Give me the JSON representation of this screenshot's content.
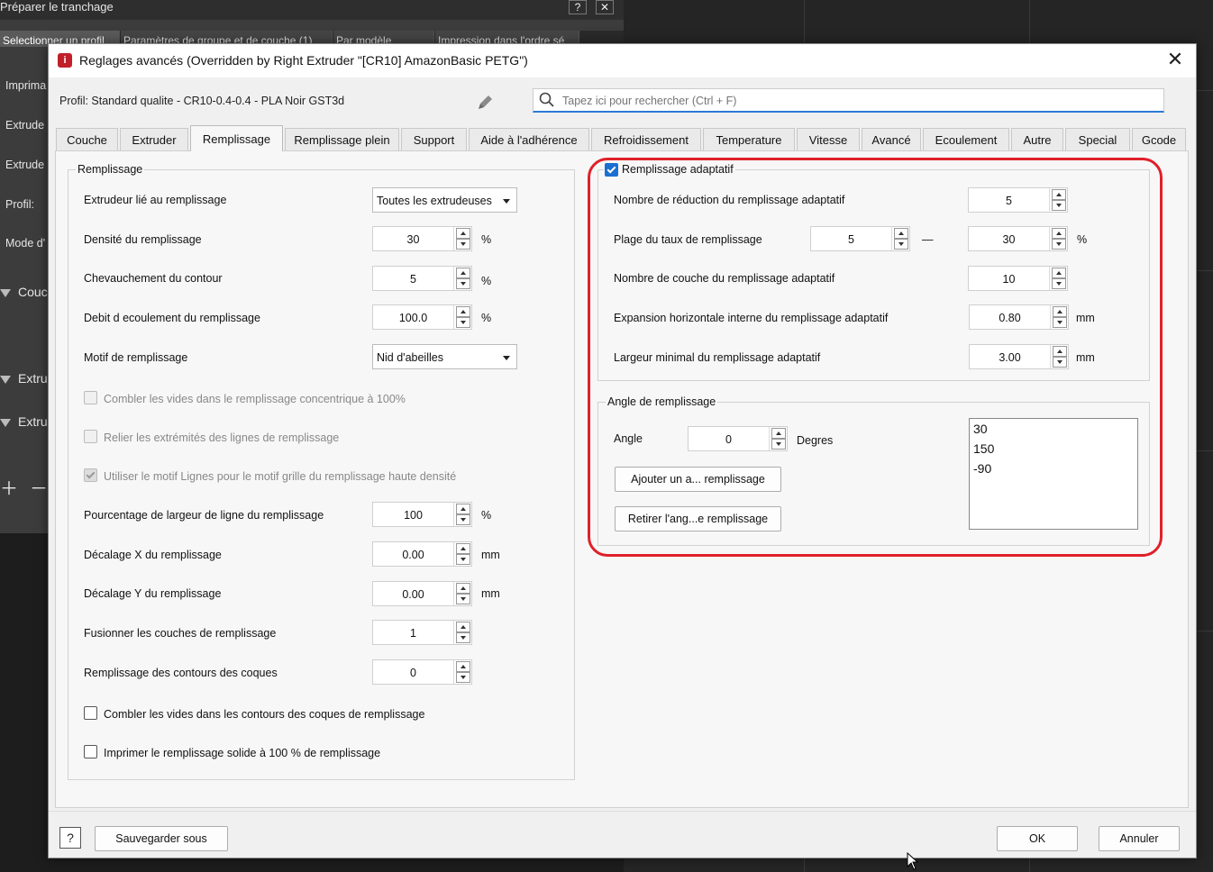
{
  "background_app": {
    "title": "Préparer le tranchage",
    "help_label": "?",
    "close_label": "✕",
    "tabs": [
      "Selectionner un profil",
      "Paramètres de groupe et de couche (1)",
      "Par modèle",
      "Impression dans l'ordre sé"
    ],
    "side_labels": [
      "Imprima",
      "Extrude",
      "Extrude",
      "Profil:",
      "Mode d'"
    ],
    "tree_items": [
      "Couc",
      "Extru",
      "Extru"
    ]
  },
  "dialog": {
    "title": "Reglages avancés (Overridden by Right Extruder \"[CR10] AmazonBasic PETG\")",
    "icon_label": "i",
    "close_label": "✕",
    "profile_label": "Profil: Standard qualite - CR10-0.4-0.4 - PLA Noir GST3d",
    "search_placeholder": "Tapez ici pour rechercher (Ctrl + F)",
    "tabs": [
      "Couche",
      "Extruder",
      "Remplissage",
      "Remplissage plein",
      "Support",
      "Aide à l'adhérence",
      "Refroidissement",
      "Temperature",
      "Vitesse",
      "Avancé",
      "Ecoulement",
      "Autre",
      "Special",
      "Gcode"
    ],
    "active_tab": "Remplissage",
    "left_group": {
      "title": "Remplissage",
      "rows": [
        {
          "label": "Extrudeur lié au remplissage",
          "type": "combo",
          "value": "Toutes les extrudeuses",
          "unit": ""
        },
        {
          "label": "Densité du remplissage",
          "type": "spin",
          "value": "30",
          "unit": "%"
        },
        {
          "label": "Chevauchement du contour",
          "type": "spin",
          "value": "5",
          "unit": "%"
        },
        {
          "label": "Debit d ecoulement du remplissage",
          "type": "spin",
          "value": "100.0",
          "unit": "%"
        },
        {
          "label": "Motif de remplissage",
          "type": "combo",
          "value": "Nid d'abeilles",
          "unit": ""
        },
        {
          "label": "Combler les vides dans le remplissage concentrique à 100%",
          "type": "check",
          "state": "disabled"
        },
        {
          "label": "Relier les extrémités des lignes de remplissage",
          "type": "check",
          "state": "disabled"
        },
        {
          "label": "Utiliser le motif Lignes pour le motif grille du remplissage haute densité",
          "type": "check",
          "state": "checked-disabled"
        },
        {
          "label": "Pourcentage de largeur de ligne du remplissage",
          "type": "spin",
          "value": "100",
          "unit": "%"
        },
        {
          "label": "Décalage X du remplissage",
          "type": "spin",
          "value": "0.00",
          "unit": "mm"
        },
        {
          "label": "Décalage Y du remplissage",
          "type": "spin",
          "value": "0.00",
          "unit": "mm"
        },
        {
          "label": "Fusionner les couches de remplissage",
          "type": "spin",
          "value": "1",
          "unit": ""
        },
        {
          "label": "Remplissage des contours des coques",
          "type": "spin",
          "value": "0",
          "unit": ""
        },
        {
          "label": "Combler les vides dans les contours des coques de remplissage",
          "type": "check",
          "state": "unchecked"
        },
        {
          "label": "Imprimer le remplissage solide à 100 % de remplissage",
          "type": "check",
          "state": "unchecked"
        }
      ]
    },
    "adaptive_group": {
      "title": "Remplissage adaptatif",
      "checked": true,
      "rows": [
        {
          "label": "Nombre de réduction du remplissage adaptatif",
          "value": "5",
          "unit": ""
        },
        {
          "label": "Plage du taux de remplissage",
          "value_min": "5",
          "separator": "—",
          "value": "30",
          "unit": "%"
        },
        {
          "label": "Nombre de couche du remplissage adaptatif",
          "value": "10",
          "unit": ""
        },
        {
          "label": "Expansion horizontale interne du remplissage adaptatif",
          "value": "0.80",
          "unit": "mm"
        },
        {
          "label": "Largeur minimal du remplissage adaptatif",
          "value": "3.00",
          "unit": "mm"
        }
      ]
    },
    "angle_group": {
      "title": "Angle de remplissage",
      "angle_label": "Angle",
      "angle_value": "0",
      "angle_unit": "Degres",
      "add_button": "Ajouter un a... remplissage",
      "remove_button": "Retirer l'ang...e remplissage",
      "angles": [
        "30",
        "150",
        "-90"
      ]
    },
    "footer": {
      "help_label": "?",
      "save_as": "Sauvegarder sous",
      "ok": "OK",
      "cancel": "Annuler"
    },
    "colors": {
      "highlight": "#e0202a",
      "accent": "#1a6fd1"
    }
  }
}
